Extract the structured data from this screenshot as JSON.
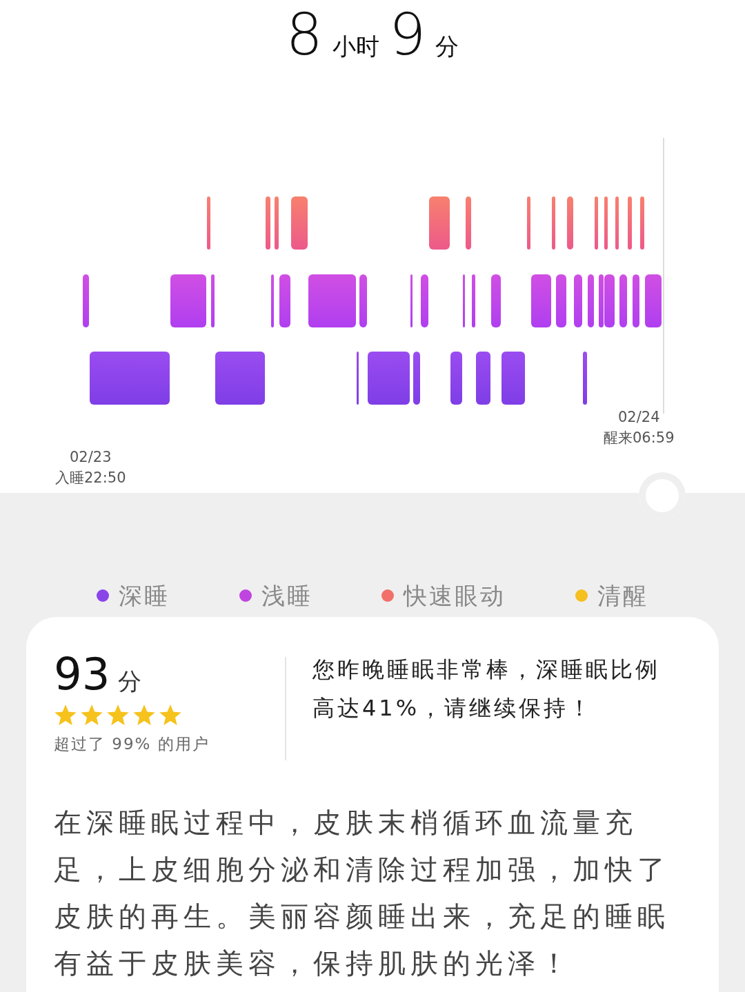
{
  "sleep_duration": {
    "hours": "8",
    "hours_unit": "小时",
    "minutes": "9",
    "minutes_unit": "分"
  },
  "hypnogram": {
    "start_date": "02/23",
    "start_label": "入睡22:50",
    "end_date": "02/24",
    "end_label": "醒来06:59"
  },
  "legend": [
    {
      "label": "深睡",
      "color": "#8a45e8"
    },
    {
      "label": "浅睡",
      "color": "#c045e0"
    },
    {
      "label": "快速眼动",
      "color": "#f2706a"
    },
    {
      "label": "清醒",
      "color": "#f5c020"
    }
  ],
  "score": {
    "value": "93",
    "unit": "分",
    "stars": 5,
    "rank_text": "超过了 99% 的用户",
    "comment": "您昨晚睡眠非常棒，深睡眠比例高达41%，请继续保持！"
  },
  "tip": "在深睡眠过程中，皮肤末梢循环血流量充足，上皮细胞分泌和清除过程加强，加快了皮肤的再生。美丽容颜睡出来，充足的睡眠有益于皮肤美容，保持肌肤的光泽！"
}
